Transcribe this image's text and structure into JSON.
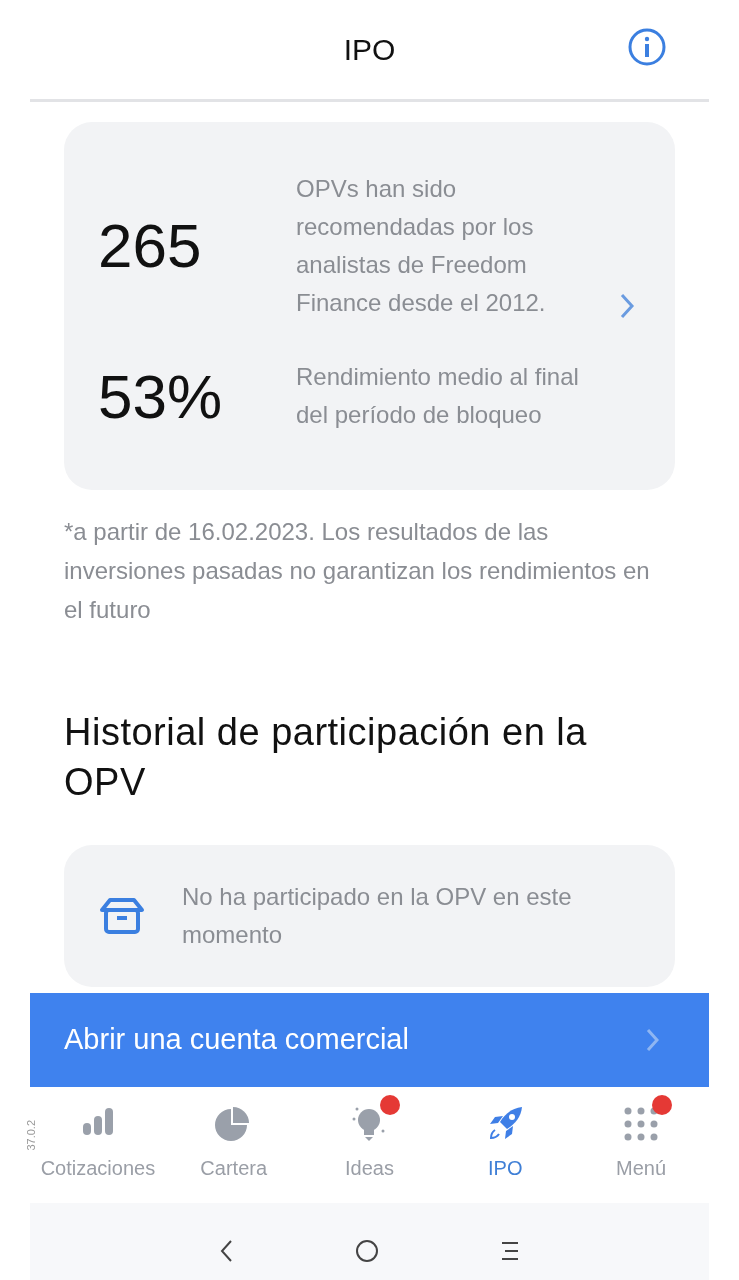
{
  "header": {
    "title": "IPO"
  },
  "stats": [
    {
      "value": "265",
      "text": "OPVs han sido recomendadas por los analistas de Freedom Finance desde el 2012."
    },
    {
      "value": "53%",
      "text": "Rendimiento medio al final del período de bloqueo"
    }
  ],
  "disclaimer": "*a partir de 16.02.2023. Los resultados de las inversiones pasadas no garantizan los rendimientos en el futuro",
  "history": {
    "title": "Historial de participación en la OPV",
    "empty_text": "No ha participado en la OPV en este momento"
  },
  "cta": {
    "label": "Abrir una cuenta comercial"
  },
  "version": "37.0.2",
  "nav": [
    {
      "kind": "bars",
      "label": "Cotizaciones",
      "selected": false,
      "badge": false
    },
    {
      "kind": "pie",
      "label": "Cartera",
      "selected": false,
      "badge": false
    },
    {
      "kind": "bulb",
      "label": "Ideas",
      "selected": false,
      "badge": true
    },
    {
      "kind": "rocket",
      "label": "IPO",
      "selected": true,
      "badge": false
    },
    {
      "kind": "dots",
      "label": "Menú",
      "selected": false,
      "badge": true
    }
  ]
}
